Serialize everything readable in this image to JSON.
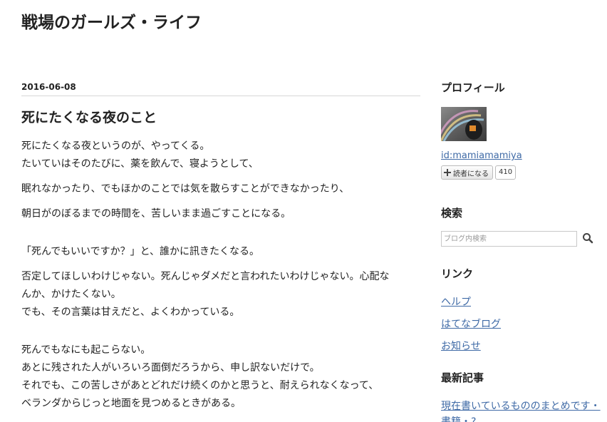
{
  "blog": {
    "title": "戦場のガールズ・ライフ"
  },
  "entry": {
    "date": "2016-06-08",
    "title": "死にたくなる夜のこと",
    "paragraphs": [
      [
        "死にたくなる夜というのが、やってくる。",
        "たいていはそのたびに、薬を飲んで、寝ようとして、"
      ],
      [
        "眠れなかったり、でもほかのことでは気を散らすことができなかったり、"
      ],
      [
        "朝日がのぼるまでの時間を、苦しいまま過ごすことになる。"
      ],
      [
        "「死んでもいいですか？」と、誰かに訊きたくなる。"
      ],
      [
        "否定してほしいわけじゃない。死んじゃダメだと言われたいわけじゃない。心配な",
        "んか、かけたくない。",
        "でも、その言葉は甘えだと、よくわかっている。"
      ],
      [
        "死んでもなにも起こらない。",
        "あとに残された人がいろいろ面倒だろうから、申し訳ないだけで。",
        "それでも、この苦しさがあとどれだけ続くのかと思うと、耐えられなくなって、",
        "ベランダからじっと地面を見つめるときがある。"
      ]
    ]
  },
  "sidebar": {
    "profile": {
      "heading": "プロフィール",
      "user_id": "id:mamiamamiya",
      "subscribe_label": "読者になる",
      "subscriber_count": "410"
    },
    "search": {
      "heading": "検索",
      "placeholder": "ブログ内検索",
      "icon": "search-icon"
    },
    "links": {
      "heading": "リンク",
      "items": [
        "ヘルプ",
        "はてなブログ",
        "お知らせ"
      ]
    },
    "recent": {
      "heading": "最新記事",
      "items": [
        "現在書いているもののまとめです・書籍・?"
      ]
    }
  },
  "colors": {
    "link": "#3f6aa6",
    "text": "#222222",
    "rule": "#d6d6d6"
  }
}
